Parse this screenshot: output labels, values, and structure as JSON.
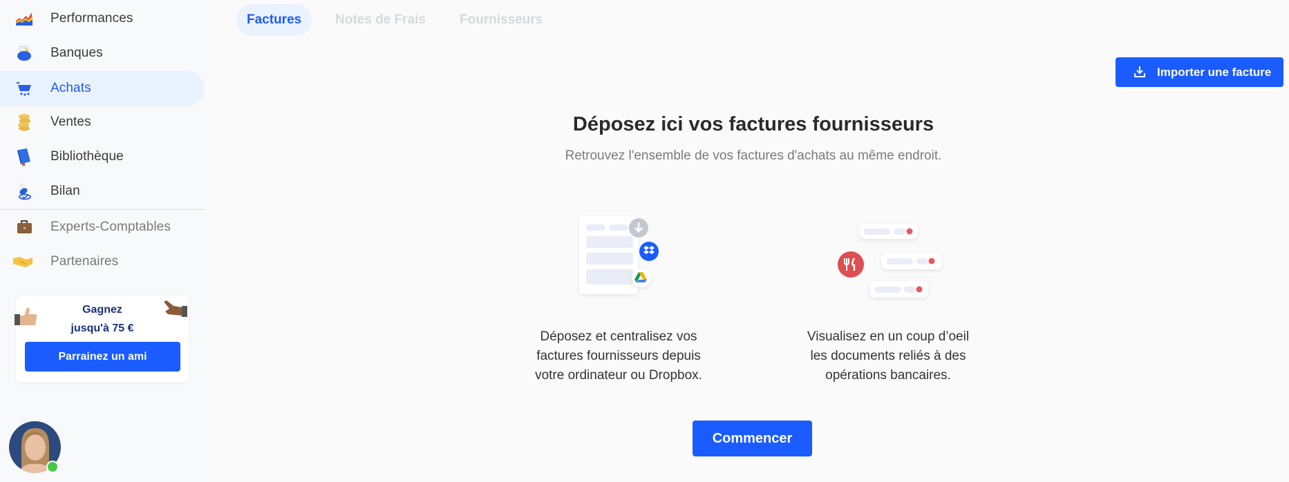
{
  "sidebar": {
    "items": [
      {
        "label": "Performances",
        "icon": "chart-area-icon",
        "state": "default"
      },
      {
        "label": "Banques",
        "icon": "bank-pot-icon",
        "state": "default"
      },
      {
        "label": "Achats",
        "icon": "shopping-cart-icon",
        "state": "active"
      },
      {
        "label": "Ventes",
        "icon": "coins-icon",
        "state": "default"
      },
      {
        "label": "Bibliothèque",
        "icon": "book-icon",
        "state": "default"
      },
      {
        "label": "Bilan",
        "icon": "stamp-icon",
        "state": "default"
      },
      {
        "label": "Experts-Comptables",
        "icon": "briefcase-icon",
        "state": "muted"
      },
      {
        "label": "Partenaires",
        "icon": "handshake-icon",
        "state": "muted"
      }
    ],
    "referral": {
      "line1": "Gagnez",
      "line2": "jusqu'à 75 €",
      "button": "Parrainez un ami"
    },
    "user": {
      "status": "online",
      "status_color": "#45c945"
    }
  },
  "tabs": [
    {
      "label": "Factures",
      "active": true
    },
    {
      "label": "Notes de Frais",
      "active": false
    },
    {
      "label": "Fournisseurs",
      "active": false
    }
  ],
  "toolbar": {
    "import_label": "Importer une facture",
    "import_icon": "download-icon"
  },
  "hero": {
    "title": "Déposez ici vos factures fournisseurs",
    "subtitle": "Retrouvez l'ensemble de vos factures d'achats au même endroit."
  },
  "features": [
    {
      "lines": [
        "Déposez et centralisez vos",
        "factures fournisseurs depuis",
        "votre ordinateur ou Dropbox."
      ],
      "icons": [
        "download-icon",
        "dropbox-icon",
        "google-drive-icon"
      ]
    },
    {
      "lines": [
        "Visualisez en un coup d’oeil",
        "les documents reliés à des",
        "opérations bancaires."
      ],
      "icons": [
        "restaurant-icon"
      ]
    }
  ],
  "cta": {
    "label": "Commencer"
  },
  "colors": {
    "accent": "#1a5cff",
    "active_text": "#1d5cf6",
    "active_bg": "#e9f2ff",
    "alert_red": "#e85a5f"
  }
}
